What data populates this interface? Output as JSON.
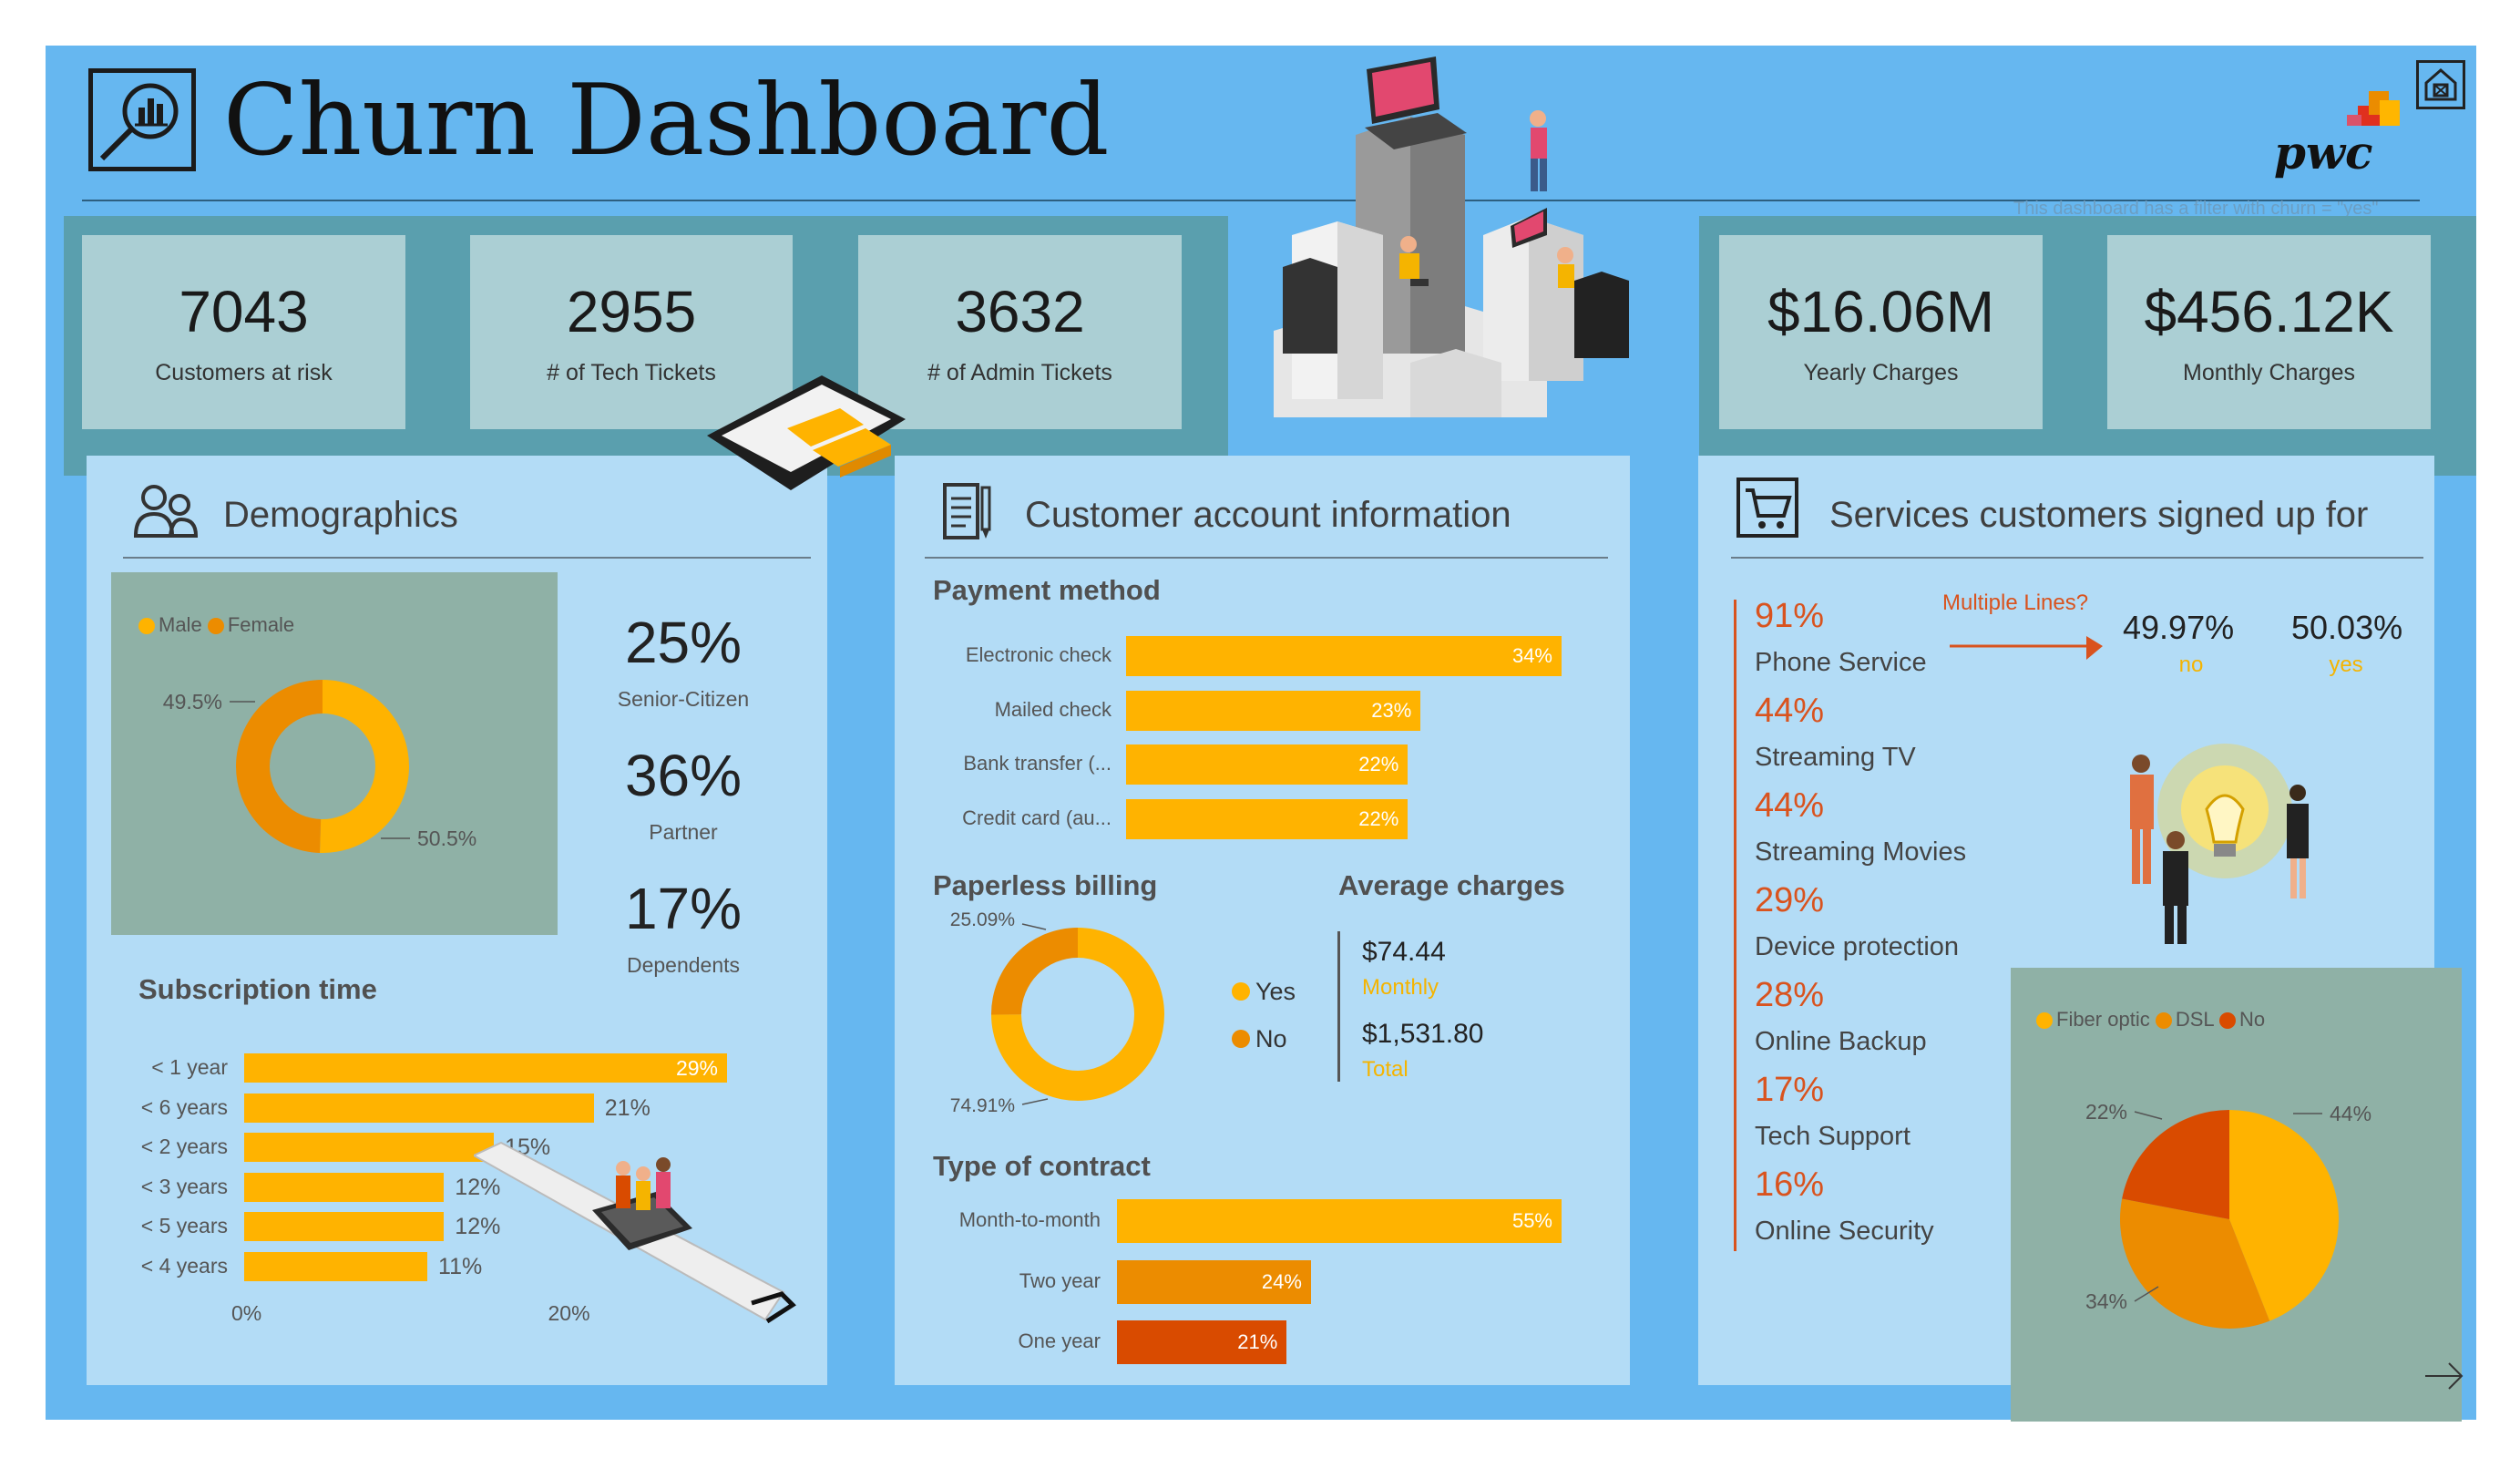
{
  "header": {
    "title": "Churn Dashboard",
    "filter_note": "This dashboard has a filter with churn = \"yes\"",
    "brand": "pwc"
  },
  "colors": {
    "orange": "#ffb300",
    "dark_orange": "#ec8c00",
    "red_orange": "#d94b00",
    "accent_text": "#d9531e",
    "gold_text": "#f5b400"
  },
  "kpis": [
    {
      "value": "7043",
      "label": "Customers at risk"
    },
    {
      "value": "2955",
      "label": "# of Tech Tickets"
    },
    {
      "value": "3632",
      "label": "# of Admin Tickets"
    },
    {
      "value": "$16.06M",
      "label": "Yearly Charges"
    },
    {
      "value": "$456.12K",
      "label": "Monthly Charges"
    }
  ],
  "demographics": {
    "title": "Demographics",
    "legend": [
      "Male",
      "Female"
    ],
    "stats": [
      {
        "value": "25%",
        "label": "Senior-Citizen"
      },
      {
        "value": "36%",
        "label": "Partner"
      },
      {
        "value": "17%",
        "label": "Dependents"
      }
    ],
    "subscription_title": "Subscription time"
  },
  "account": {
    "title": "Customer account information",
    "payment_title": "Payment method",
    "paperless_title": "Paperless billing",
    "avg_title": "Average charges",
    "avg_monthly_value": "$74.44",
    "avg_monthly_label": "Monthly",
    "avg_total_value": "$1,531.80",
    "avg_total_label": "Total",
    "contract_title": "Type of contract"
  },
  "services": {
    "title": "Services customers signed up for",
    "multiple_lines_label": "Multiple Lines?",
    "multiple_no_value": "49.97%",
    "multiple_no_label": "no",
    "multiple_yes_value": "50.03%",
    "multiple_yes_label": "yes",
    "items": [
      {
        "pct": "91%",
        "name": "Phone Service"
      },
      {
        "pct": "44%",
        "name": "Streaming TV"
      },
      {
        "pct": "44%",
        "name": "Streaming Movies"
      },
      {
        "pct": "29%",
        "name": "Device protection"
      },
      {
        "pct": "28%",
        "name": "Online Backup"
      },
      {
        "pct": "17%",
        "name": "Tech Support"
      },
      {
        "pct": "16%",
        "name": "Online Security"
      }
    ]
  },
  "chart_data": [
    {
      "type": "pie",
      "name": "gender",
      "categories": [
        "Male",
        "Female"
      ],
      "values": [
        50.5,
        49.5
      ],
      "labels": [
        "50.5%",
        "49.5%"
      ],
      "donut": true,
      "legend": "top-left"
    },
    {
      "type": "bar",
      "name": "subscription_time",
      "orientation": "horizontal",
      "categories": [
        "< 1 year",
        "< 6 years",
        "< 2 years",
        "< 3 years",
        "< 5 years",
        "< 4 years"
      ],
      "values": [
        29,
        21,
        15,
        12,
        12,
        11
      ],
      "labels": [
        "29%",
        "21%",
        "15%",
        "12%",
        "12%",
        "11%"
      ],
      "x_ticks": [
        "0%",
        "20%"
      ]
    },
    {
      "type": "bar",
      "name": "payment_method",
      "orientation": "horizontal",
      "categories": [
        "Electronic check",
        "Mailed check",
        "Bank transfer (...",
        "Credit card (au..."
      ],
      "values": [
        34,
        23,
        22,
        22
      ],
      "labels": [
        "34%",
        "23%",
        "22%",
        "22%"
      ]
    },
    {
      "type": "pie",
      "name": "paperless_billing",
      "categories": [
        "Yes",
        "No"
      ],
      "values": [
        74.91,
        25.09
      ],
      "labels": [
        "74.91%",
        "25.09%"
      ],
      "donut": true,
      "legend": "right"
    },
    {
      "type": "bar",
      "name": "contract",
      "orientation": "horizontal",
      "categories": [
        "Month-to-month",
        "Two year",
        "One year"
      ],
      "values": [
        55,
        24,
        21
      ],
      "labels": [
        "55%",
        "24%",
        "21%"
      ]
    },
    {
      "type": "pie",
      "name": "internet_service",
      "categories": [
        "Fiber optic",
        "DSL",
        "No"
      ],
      "values": [
        44,
        34,
        22
      ],
      "labels": [
        "44%",
        "34%",
        "22%"
      ],
      "legend": "top-left"
    }
  ]
}
